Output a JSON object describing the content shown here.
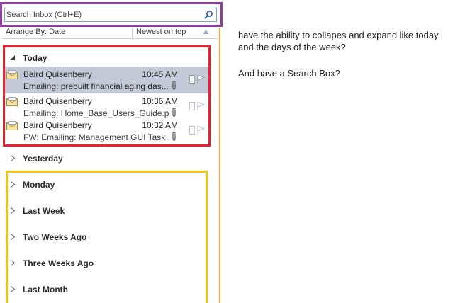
{
  "search": {
    "placeholder": "Search Inbox (Ctrl+E)"
  },
  "arrange": {
    "label": "Arrange By: Date",
    "order": "Newest on top"
  },
  "groups": {
    "today": "Today",
    "yesterday": "Yesterday",
    "monday": "Monday",
    "last_week": "Last Week",
    "two_weeks_ago": "Two Weeks Ago",
    "three_weeks_ago": "Three Weeks Ago",
    "last_month": "Last Month"
  },
  "emails": [
    {
      "sender": "Baird Quisenberry",
      "time": "10:45 AM",
      "subject": "Emailing: prebuilt financial aging das..."
    },
    {
      "sender": "Baird Quisenberry",
      "time": "10:36 AM",
      "subject": "Emailing: Home_Base_Users_Guide.pdf"
    },
    {
      "sender": "Baird Quisenberry",
      "time": "10:32 AM",
      "subject": "FW: Emailing: Management GUI Task ..."
    }
  ],
  "notes": {
    "line1": "have the ability to collapes and expand like today",
    "line2": "and the days of the week?",
    "line3": "And have a Search Box?"
  },
  "colors": {
    "search_highlight": "#8c3fa0",
    "today_highlight": "#e8232f",
    "groups_highlight": "#f2c40f",
    "selected_row": "#c3c9d6"
  }
}
